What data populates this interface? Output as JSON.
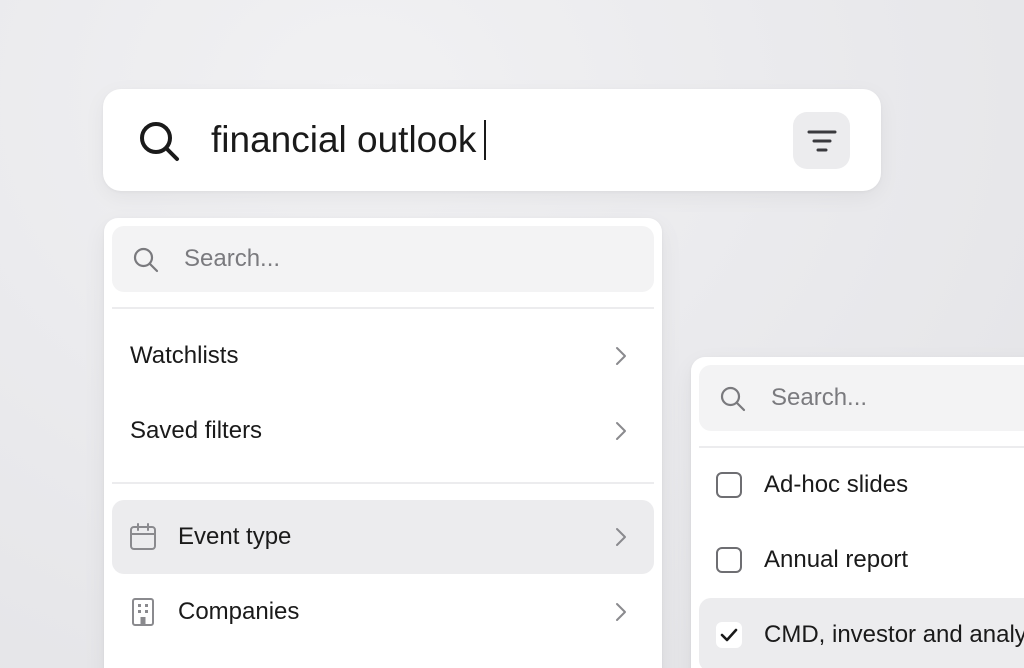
{
  "main_search": {
    "query": "financial outlook",
    "icon": "search-icon",
    "filter_icon": "filter-lines-icon"
  },
  "left_panel": {
    "search_placeholder": "Search...",
    "nav_items": [
      {
        "label": "Watchlists"
      },
      {
        "label": "Saved filters"
      }
    ],
    "filter_items": [
      {
        "label": "Event type",
        "icon": "calendar-icon",
        "active": true
      },
      {
        "label": "Companies",
        "icon": "building-icon",
        "active": false
      }
    ]
  },
  "right_panel": {
    "search_placeholder": "Search...",
    "options": [
      {
        "label": "Ad-hoc slides",
        "checked": false
      },
      {
        "label": "Annual report",
        "checked": false
      },
      {
        "label": "CMD, investor and analyst day",
        "checked": true
      }
    ]
  },
  "colors": {
    "background": "#e9e9ec",
    "panel": "#ffffff",
    "active_row": "#ececee",
    "text": "#1a1a1a",
    "placeholder": "#7a7a7e"
  }
}
